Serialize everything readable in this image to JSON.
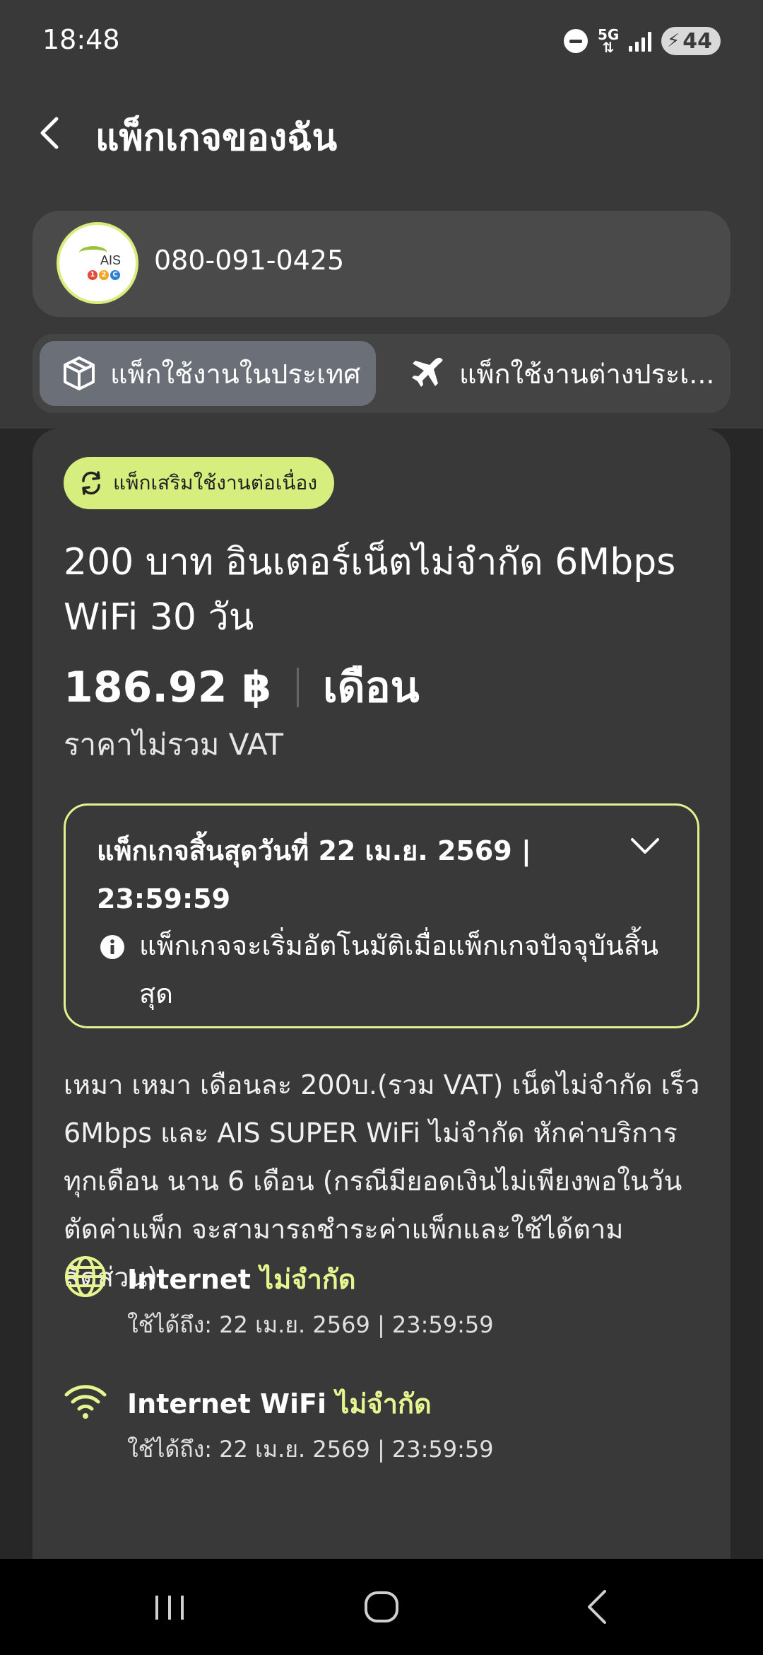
{
  "status_bar": {
    "time": "18:48",
    "network": "5G",
    "battery": "44"
  },
  "header": {
    "title": "แพ็กเกจของฉัน"
  },
  "account": {
    "phone_number": "080-091-0425",
    "logo_text": "AIS",
    "logo_sub": [
      "1",
      "2",
      "C"
    ]
  },
  "tabs": [
    {
      "label": "แพ็กใช้งานในประเทศ",
      "icon": "package-icon",
      "active": true
    },
    {
      "label": "แพ็กใช้งานต่างประเ...",
      "icon": "airplane-icon",
      "active": false
    }
  ],
  "package": {
    "badge": "แพ็กเสริมใช้งานต่อเนื่อง",
    "title": "200 บาท อินเตอร์เน็ตไม่จำกัด 6Mbps WiFi 30 วัน",
    "price": "186.92 ฿",
    "period": "เดือน",
    "vat_note": "ราคาไม่รวม VAT",
    "expiry": "แพ็กเกจสิ้นสุดวันที่ 22 เม.ย. 2569 | 23:59:59",
    "auto_note": "แพ็กเกจจะเริ่มอัตโนมัติเมื่อแพ็กเกจปัจจุบันสิ้นสุด",
    "description": "เหมา เหมา เดือนละ 200บ.(รวม VAT) เน็ตไม่จำกัด เร็ว 6Mbps และ AIS SUPER WiFi ไม่จำกัด หักค่าบริการทุกเดือน นาน 6 เดือน (กรณีมียอดเงินไม่เพียงพอในวันตัดค่าแพ็ก จะสามารถชำระค่าแพ็กและใช้ได้ตามสัดส่วน)",
    "features": [
      {
        "name": "Internet",
        "value": "ไม่จำกัด",
        "valid": "ใช้ได้ถึง: 22 เม.ย. 2569 | 23:59:59",
        "icon": "globe-icon"
      },
      {
        "name": "Internet WiFi",
        "value": "ไม่จำกัด",
        "valid": "ใช้ได้ถึง: 22 เม.ย. 2569 | 23:59:59",
        "icon": "wifi-icon"
      }
    ]
  },
  "colors": {
    "accent": "#e6f58f",
    "badge_bg": "#d5ee7e",
    "background": "#393939"
  }
}
